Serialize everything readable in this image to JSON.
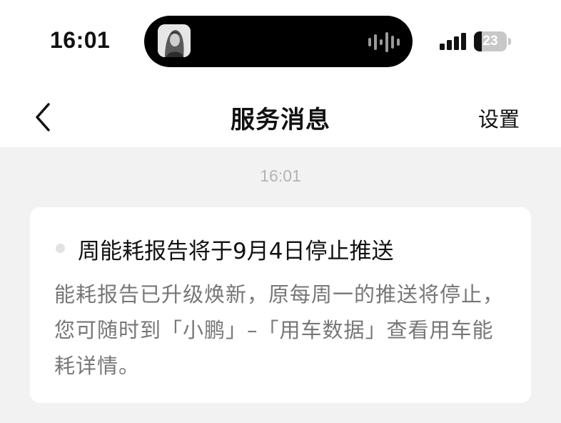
{
  "status_bar": {
    "time": "16:01",
    "battery_level": "23",
    "battery_fraction": 0.23,
    "album_art_icon": "album-art-portrait",
    "waveform_icon": "audio-waveform-icon",
    "signal_icon": "cellular-signal-icon"
  },
  "nav": {
    "back_icon": "chevron-left-icon",
    "title": "服务消息",
    "settings_label": "设置"
  },
  "messages": [
    {
      "timestamp": "16:01",
      "title": "周能耗报告将于9月4日停止推送",
      "body": "能耗报告已升级焕新，原每周一的推送将停止，您可随时到「小鹏」–「用车数据」查看用车能耗详情。"
    }
  ],
  "colors": {
    "page_background": "#f2f2f2",
    "card_background": "#ffffff",
    "body_text": "#777777",
    "timestamp_text": "#b3b3b3"
  }
}
